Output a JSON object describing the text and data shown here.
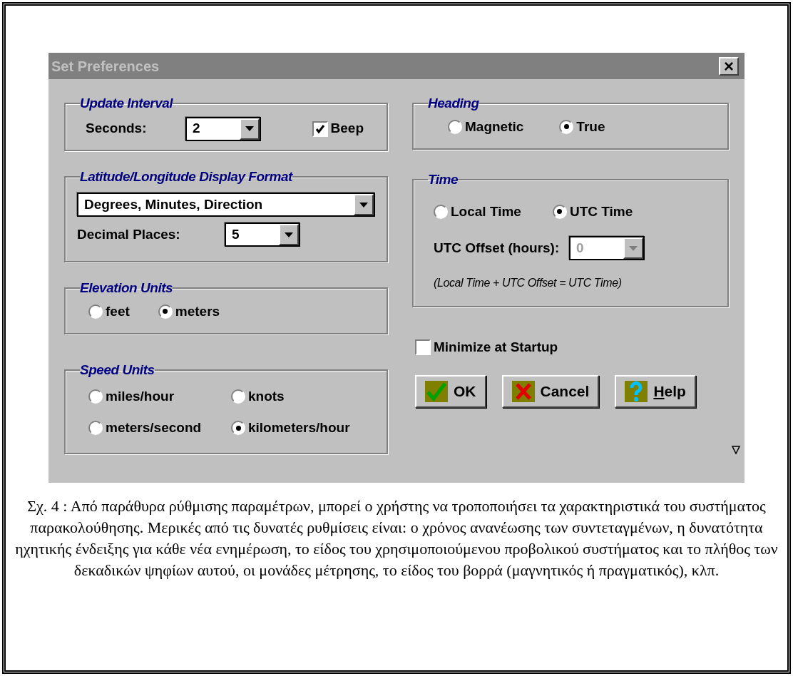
{
  "dialog": {
    "title": "Set Preferences",
    "close": "×"
  },
  "update_interval": {
    "title": "Update Interval",
    "seconds_label": "Seconds:",
    "seconds_value": "2",
    "beep": {
      "label": "Beep",
      "checked": true
    }
  },
  "latlong": {
    "title": "Latitude/Longitude Display Format",
    "format_value": "Degrees, Minutes, Direction",
    "decimal_label": "Decimal Places:",
    "decimal_value": "5"
  },
  "elevation": {
    "title": "Elevation Units",
    "options": [
      {
        "label": "feet",
        "selected": false
      },
      {
        "label": "meters",
        "selected": true
      }
    ]
  },
  "speed": {
    "title": "Speed Units",
    "options": [
      {
        "label": "miles/hour",
        "selected": false
      },
      {
        "label": "knots",
        "selected": false
      },
      {
        "label": "meters/second",
        "selected": false
      },
      {
        "label": "kilometers/hour",
        "selected": true
      }
    ]
  },
  "heading": {
    "title": "Heading",
    "options": [
      {
        "label": "Magnetic",
        "selected": false
      },
      {
        "label": "True",
        "selected": true
      }
    ]
  },
  "time": {
    "title": "Time",
    "options": [
      {
        "label": "Local Time",
        "selected": false
      },
      {
        "label": "UTC Time",
        "selected": true
      }
    ],
    "offset_label": "UTC Offset (hours):",
    "offset_value": "0",
    "offset_disabled": true,
    "note": "(Local Time + UTC Offset = UTC Time)"
  },
  "minimize": {
    "label": "Minimize at Startup",
    "checked": false
  },
  "buttons": [
    {
      "kind": "ok",
      "label": "OK"
    },
    {
      "kind": "cancel",
      "label": "Cancel"
    },
    {
      "kind": "help",
      "accel": "H",
      "label": "elp"
    }
  ],
  "caption": "Σχ. 4 : Από παράθυρα ρύθμισης παραμέτρων, μπορεί ο χρήστης να τροποποιήσει τα χαρακτηριστικά του συστήματος παρακολούθησης. Μερικές από τις δυνατές ρυθμίσεις είναι: ο χρόνος ανανέωσης των συντεταγμένων, η δυνατότητα ηχητικής ένδειξης για κάθε νέα ενημέρωση, το είδος του χρησιμοποιούμενου προβολικού συστήματος και το πλήθος των δεκαδικών ψηφίων αυτού, οι μονάδες μέτρησης, το είδος του βορρά (μαγνητικός ή πραγματικός), κλπ."
}
